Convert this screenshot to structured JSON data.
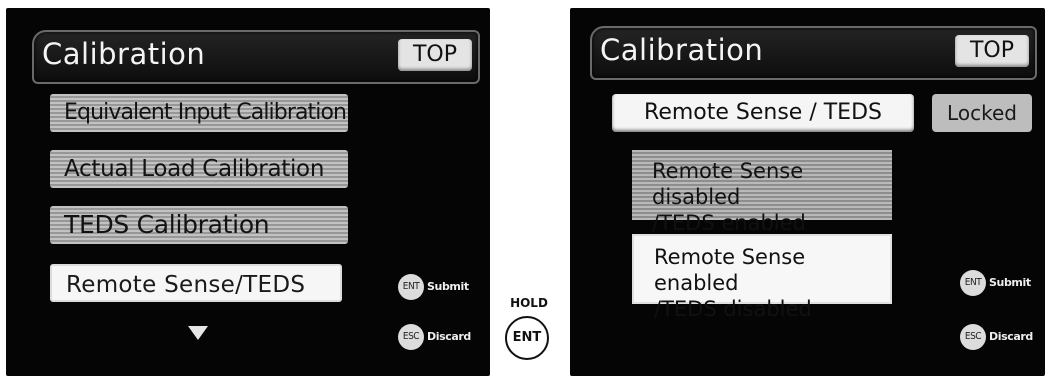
{
  "left_screen": {
    "title": "Calibration",
    "top_button": "TOP",
    "menu_items": [
      "Equivalent Input Calibration",
      "Actual Load Calibration",
      "TEDS Calibration",
      "Remote Sense/TEDS"
    ],
    "selected_index": 3,
    "submit_key": "ENT",
    "submit_label": "Submit",
    "discard_key": "ESC",
    "discard_label": "Discard"
  },
  "hold_control": {
    "label": "HOLD",
    "key": "ENT"
  },
  "right_screen": {
    "title": "Calibration",
    "top_button": "TOP",
    "header": "Remote Sense / TEDS",
    "status": "Locked",
    "options": [
      {
        "line1": "Remote Sense disabled",
        "line2": "/TEDS enabled"
      },
      {
        "line1": "Remote Sense enabled",
        "line2": "/TEDS disabled"
      }
    ],
    "selected_option": 1,
    "submit_key": "ENT",
    "submit_label": "Submit",
    "discard_key": "ESC",
    "discard_label": "Discard"
  }
}
